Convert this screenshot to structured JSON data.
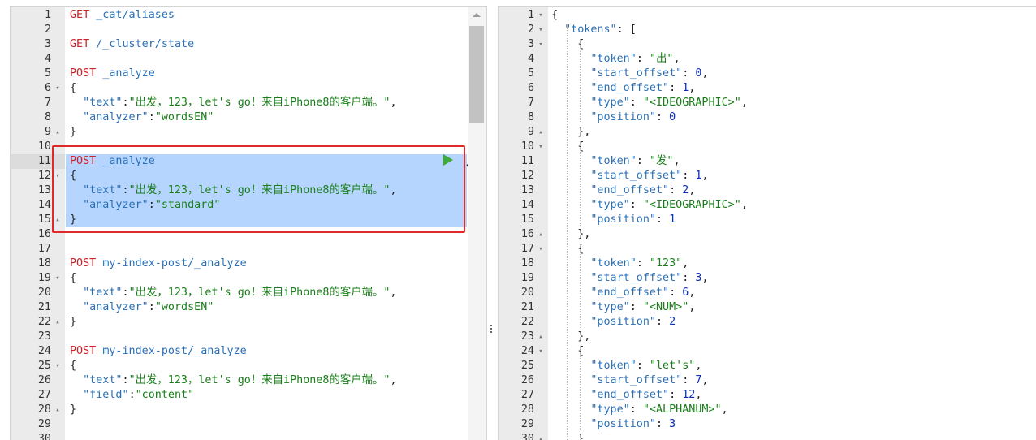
{
  "request_editor": {
    "lines": [
      {
        "n": "1",
        "fold": "",
        "segments": [
          {
            "t": "GET ",
            "c": "verb"
          },
          {
            "t": "_cat/aliases",
            "c": "url"
          }
        ]
      },
      {
        "n": "2",
        "fold": "",
        "segments": []
      },
      {
        "n": "3",
        "fold": "",
        "segments": [
          {
            "t": "GET ",
            "c": "verb"
          },
          {
            "t": "/_cluster/state",
            "c": "url"
          }
        ]
      },
      {
        "n": "4",
        "fold": "",
        "segments": []
      },
      {
        "n": "5",
        "fold": "",
        "segments": [
          {
            "t": "POST ",
            "c": "verb"
          },
          {
            "t": "_analyze",
            "c": "url"
          }
        ]
      },
      {
        "n": "6",
        "fold": "▾",
        "segments": [
          {
            "t": "{",
            "c": "pun"
          }
        ]
      },
      {
        "n": "7",
        "fold": "",
        "segments": [
          {
            "t": "  \"text\"",
            "c": "key"
          },
          {
            "t": ":",
            "c": "pun"
          },
          {
            "t": "\"出发，123，let's go！来自iPhone8的客户端。\"",
            "c": "str"
          },
          {
            "t": ",",
            "c": "pun"
          }
        ]
      },
      {
        "n": "8",
        "fold": "",
        "segments": [
          {
            "t": "  \"analyzer\"",
            "c": "key"
          },
          {
            "t": ":",
            "c": "pun"
          },
          {
            "t": "\"wordsEN\"",
            "c": "str"
          }
        ]
      },
      {
        "n": "9",
        "fold": "▴",
        "segments": [
          {
            "t": "}",
            "c": "pun"
          }
        ]
      },
      {
        "n": "10",
        "fold": "",
        "segments": []
      },
      {
        "n": "11",
        "fold": "",
        "segments": [
          {
            "t": "POST ",
            "c": "verb"
          },
          {
            "t": "_analyze",
            "c": "url"
          }
        ]
      },
      {
        "n": "12",
        "fold": "▾",
        "segments": [
          {
            "t": "{",
            "c": "pun"
          }
        ]
      },
      {
        "n": "13",
        "fold": "",
        "segments": [
          {
            "t": "  \"text\"",
            "c": "key"
          },
          {
            "t": ":",
            "c": "pun"
          },
          {
            "t": "\"出发，123，let's go！来自iPhone8的客户端。\"",
            "c": "str"
          },
          {
            "t": ",",
            "c": "pun"
          }
        ]
      },
      {
        "n": "14",
        "fold": "",
        "segments": [
          {
            "t": "  \"analyzer\"",
            "c": "key"
          },
          {
            "t": ":",
            "c": "pun"
          },
          {
            "t": "\"standard\"",
            "c": "str"
          }
        ]
      },
      {
        "n": "15",
        "fold": "▴",
        "segments": [
          {
            "t": "}",
            "c": "pun"
          }
        ]
      },
      {
        "n": "16",
        "fold": "",
        "segments": []
      },
      {
        "n": "17",
        "fold": "",
        "segments": []
      },
      {
        "n": "18",
        "fold": "",
        "segments": [
          {
            "t": "POST ",
            "c": "verb"
          },
          {
            "t": "my-index-post/_analyze",
            "c": "url"
          }
        ]
      },
      {
        "n": "19",
        "fold": "▾",
        "segments": [
          {
            "t": "{",
            "c": "pun"
          }
        ]
      },
      {
        "n": "20",
        "fold": "",
        "segments": [
          {
            "t": "  \"text\"",
            "c": "key"
          },
          {
            "t": ":",
            "c": "pun"
          },
          {
            "t": "\"出发，123，let's go！来自iPhone8的客户端。\"",
            "c": "str"
          },
          {
            "t": ",",
            "c": "pun"
          }
        ]
      },
      {
        "n": "21",
        "fold": "",
        "segments": [
          {
            "t": "  \"analyzer\"",
            "c": "key"
          },
          {
            "t": ":",
            "c": "pun"
          },
          {
            "t": "\"wordsEN\"",
            "c": "str"
          }
        ]
      },
      {
        "n": "22",
        "fold": "▴",
        "segments": [
          {
            "t": "}",
            "c": "pun"
          }
        ]
      },
      {
        "n": "23",
        "fold": "",
        "segments": []
      },
      {
        "n": "24",
        "fold": "",
        "segments": [
          {
            "t": "POST ",
            "c": "verb"
          },
          {
            "t": "my-index-post/_analyze",
            "c": "url"
          }
        ]
      },
      {
        "n": "25",
        "fold": "▾",
        "segments": [
          {
            "t": "{",
            "c": "pun"
          }
        ]
      },
      {
        "n": "26",
        "fold": "",
        "segments": [
          {
            "t": "  \"text\"",
            "c": "key"
          },
          {
            "t": ":",
            "c": "pun"
          },
          {
            "t": "\"出发，123，let's go！来自iPhone8的客户端。\"",
            "c": "str"
          },
          {
            "t": ",",
            "c": "pun"
          }
        ]
      },
      {
        "n": "27",
        "fold": "",
        "segments": [
          {
            "t": "  \"field\"",
            "c": "key"
          },
          {
            "t": ":",
            "c": "pun"
          },
          {
            "t": "\"content\"",
            "c": "str"
          }
        ]
      },
      {
        "n": "28",
        "fold": "▴",
        "segments": [
          {
            "t": "}",
            "c": "pun"
          }
        ]
      },
      {
        "n": "29",
        "fold": "",
        "segments": []
      },
      {
        "n": "30",
        "fold": "",
        "segments": []
      }
    ]
  },
  "response_viewer": {
    "lines": [
      {
        "n": "1",
        "fold": "▾",
        "segments": [
          {
            "t": "{",
            "c": "pun"
          }
        ]
      },
      {
        "n": "2",
        "fold": "▾",
        "segments": [
          {
            "t": "  \"tokens\"",
            "c": "key"
          },
          {
            "t": ": [",
            "c": "pun"
          }
        ]
      },
      {
        "n": "3",
        "fold": "▾",
        "segments": [
          {
            "t": "    {",
            "c": "pun"
          }
        ]
      },
      {
        "n": "4",
        "fold": "",
        "segments": [
          {
            "t": "      \"token\"",
            "c": "key"
          },
          {
            "t": ": ",
            "c": "pun"
          },
          {
            "t": "\"出\"",
            "c": "str"
          },
          {
            "t": ",",
            "c": "pun"
          }
        ]
      },
      {
        "n": "5",
        "fold": "",
        "segments": [
          {
            "t": "      \"start_offset\"",
            "c": "key"
          },
          {
            "t": ": ",
            "c": "pun"
          },
          {
            "t": "0",
            "c": "num"
          },
          {
            "t": ",",
            "c": "pun"
          }
        ]
      },
      {
        "n": "6",
        "fold": "",
        "segments": [
          {
            "t": "      \"end_offset\"",
            "c": "key"
          },
          {
            "t": ": ",
            "c": "pun"
          },
          {
            "t": "1",
            "c": "num"
          },
          {
            "t": ",",
            "c": "pun"
          }
        ]
      },
      {
        "n": "7",
        "fold": "",
        "segments": [
          {
            "t": "      \"type\"",
            "c": "key"
          },
          {
            "t": ": ",
            "c": "pun"
          },
          {
            "t": "\"<IDEOGRAPHIC>\"",
            "c": "str"
          },
          {
            "t": ",",
            "c": "pun"
          }
        ]
      },
      {
        "n": "8",
        "fold": "",
        "segments": [
          {
            "t": "      \"position\"",
            "c": "key"
          },
          {
            "t": ": ",
            "c": "pun"
          },
          {
            "t": "0",
            "c": "num"
          }
        ]
      },
      {
        "n": "9",
        "fold": "▴",
        "segments": [
          {
            "t": "    },",
            "c": "pun"
          }
        ]
      },
      {
        "n": "10",
        "fold": "▾",
        "segments": [
          {
            "t": "    {",
            "c": "pun"
          }
        ]
      },
      {
        "n": "11",
        "fold": "",
        "segments": [
          {
            "t": "      \"token\"",
            "c": "key"
          },
          {
            "t": ": ",
            "c": "pun"
          },
          {
            "t": "\"发\"",
            "c": "str"
          },
          {
            "t": ",",
            "c": "pun"
          }
        ]
      },
      {
        "n": "12",
        "fold": "",
        "segments": [
          {
            "t": "      \"start_offset\"",
            "c": "key"
          },
          {
            "t": ": ",
            "c": "pun"
          },
          {
            "t": "1",
            "c": "num"
          },
          {
            "t": ",",
            "c": "pun"
          }
        ]
      },
      {
        "n": "13",
        "fold": "",
        "segments": [
          {
            "t": "      \"end_offset\"",
            "c": "key"
          },
          {
            "t": ": ",
            "c": "pun"
          },
          {
            "t": "2",
            "c": "num"
          },
          {
            "t": ",",
            "c": "pun"
          }
        ]
      },
      {
        "n": "14",
        "fold": "",
        "segments": [
          {
            "t": "      \"type\"",
            "c": "key"
          },
          {
            "t": ": ",
            "c": "pun"
          },
          {
            "t": "\"<IDEOGRAPHIC>\"",
            "c": "str"
          },
          {
            "t": ",",
            "c": "pun"
          }
        ]
      },
      {
        "n": "15",
        "fold": "",
        "segments": [
          {
            "t": "      \"position\"",
            "c": "key"
          },
          {
            "t": ": ",
            "c": "pun"
          },
          {
            "t": "1",
            "c": "num"
          }
        ]
      },
      {
        "n": "16",
        "fold": "▴",
        "segments": [
          {
            "t": "    },",
            "c": "pun"
          }
        ]
      },
      {
        "n": "17",
        "fold": "▾",
        "segments": [
          {
            "t": "    {",
            "c": "pun"
          }
        ]
      },
      {
        "n": "18",
        "fold": "",
        "segments": [
          {
            "t": "      \"token\"",
            "c": "key"
          },
          {
            "t": ": ",
            "c": "pun"
          },
          {
            "t": "\"123\"",
            "c": "str"
          },
          {
            "t": ",",
            "c": "pun"
          }
        ]
      },
      {
        "n": "19",
        "fold": "",
        "segments": [
          {
            "t": "      \"start_offset\"",
            "c": "key"
          },
          {
            "t": ": ",
            "c": "pun"
          },
          {
            "t": "3",
            "c": "num"
          },
          {
            "t": ",",
            "c": "pun"
          }
        ]
      },
      {
        "n": "20",
        "fold": "",
        "segments": [
          {
            "t": "      \"end_offset\"",
            "c": "key"
          },
          {
            "t": ": ",
            "c": "pun"
          },
          {
            "t": "6",
            "c": "num"
          },
          {
            "t": ",",
            "c": "pun"
          }
        ]
      },
      {
        "n": "21",
        "fold": "",
        "segments": [
          {
            "t": "      \"type\"",
            "c": "key"
          },
          {
            "t": ": ",
            "c": "pun"
          },
          {
            "t": "\"<NUM>\"",
            "c": "str"
          },
          {
            "t": ",",
            "c": "pun"
          }
        ]
      },
      {
        "n": "22",
        "fold": "",
        "segments": [
          {
            "t": "      \"position\"",
            "c": "key"
          },
          {
            "t": ": ",
            "c": "pun"
          },
          {
            "t": "2",
            "c": "num"
          }
        ]
      },
      {
        "n": "23",
        "fold": "▴",
        "segments": [
          {
            "t": "    },",
            "c": "pun"
          }
        ]
      },
      {
        "n": "24",
        "fold": "▾",
        "segments": [
          {
            "t": "    {",
            "c": "pun"
          }
        ]
      },
      {
        "n": "25",
        "fold": "",
        "segments": [
          {
            "t": "      \"token\"",
            "c": "key"
          },
          {
            "t": ": ",
            "c": "pun"
          },
          {
            "t": "\"let's\"",
            "c": "str"
          },
          {
            "t": ",",
            "c": "pun"
          }
        ]
      },
      {
        "n": "26",
        "fold": "",
        "segments": [
          {
            "t": "      \"start_offset\"",
            "c": "key"
          },
          {
            "t": ": ",
            "c": "pun"
          },
          {
            "t": "7",
            "c": "num"
          },
          {
            "t": ",",
            "c": "pun"
          }
        ]
      },
      {
        "n": "27",
        "fold": "",
        "segments": [
          {
            "t": "      \"end_offset\"",
            "c": "key"
          },
          {
            "t": ": ",
            "c": "pun"
          },
          {
            "t": "12",
            "c": "num"
          },
          {
            "t": ",",
            "c": "pun"
          }
        ]
      },
      {
        "n": "28",
        "fold": "",
        "segments": [
          {
            "t": "      \"type\"",
            "c": "key"
          },
          {
            "t": ": ",
            "c": "pun"
          },
          {
            "t": "\"<ALPHANUM>\"",
            "c": "str"
          },
          {
            "t": ",",
            "c": "pun"
          }
        ]
      },
      {
        "n": "29",
        "fold": "",
        "segments": [
          {
            "t": "      \"position\"",
            "c": "key"
          },
          {
            "t": ": ",
            "c": "pun"
          },
          {
            "t": "3",
            "c": "num"
          }
        ]
      },
      {
        "n": "30",
        "fold": "▴",
        "segments": [
          {
            "t": "    }",
            "c": "pun"
          }
        ]
      }
    ]
  },
  "selection": {
    "active_line": "11",
    "selected_lines": [
      "11",
      "12",
      "13",
      "14",
      "15"
    ]
  },
  "icons": {
    "run": "play-icon",
    "settings": "wrench-icon",
    "resize": "resize-handle-icon"
  },
  "colors": {
    "verb": "#cc2228",
    "url": "#2a70b7",
    "string": "#1a7f1a",
    "number": "#0b2fbb",
    "selection": "#b5d5ff",
    "highlight_box": "#e02a2a",
    "run_button": "#3fa83f"
  }
}
